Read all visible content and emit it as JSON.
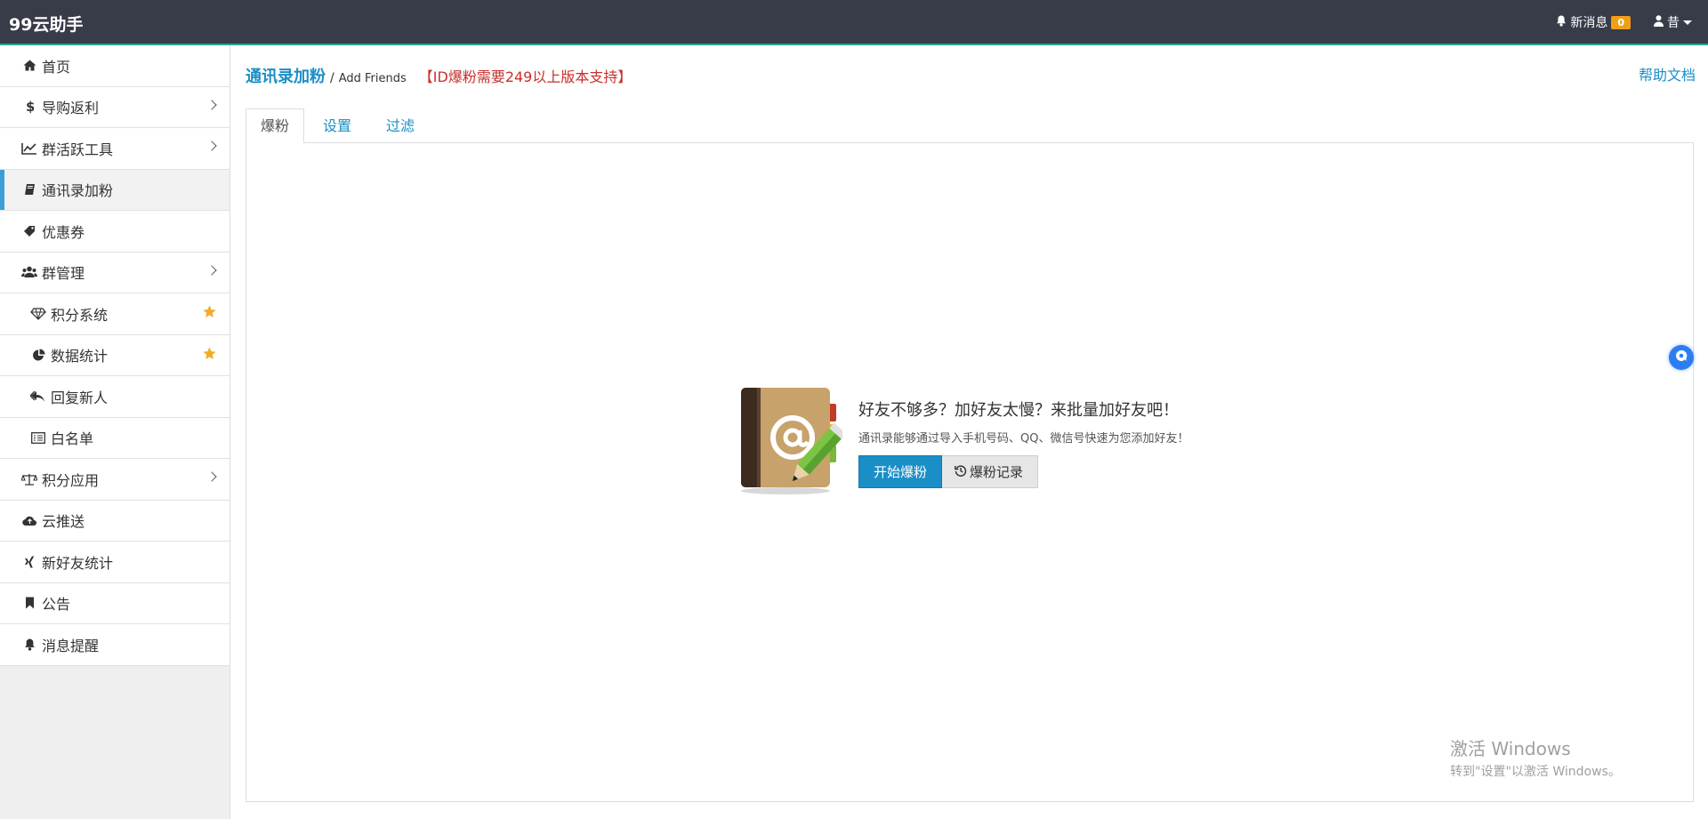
{
  "header": {
    "brand": "99云助手",
    "messages_label": "新消息",
    "messages_count": "0",
    "user_name": "昔"
  },
  "sidebar": {
    "items": [
      {
        "label": "首页",
        "icon": "home-icon"
      },
      {
        "label": "导购返利",
        "icon": "dollar-icon",
        "has_submenu": true
      },
      {
        "label": "群活跃工具",
        "icon": "line-chart-icon",
        "has_submenu": true
      },
      {
        "label": "通讯录加粉",
        "icon": "book-icon",
        "active": true
      },
      {
        "label": "优惠券",
        "icon": "tag-icon"
      },
      {
        "label": "群管理",
        "icon": "users-icon",
        "has_submenu": true
      },
      {
        "label": "积分系统",
        "icon": "diamond-icon",
        "starred": true
      },
      {
        "label": "数据统计",
        "icon": "pie-chart-icon",
        "starred": true
      },
      {
        "label": "回复新人",
        "icon": "reply-all-icon"
      },
      {
        "label": "白名单",
        "icon": "list-icon"
      },
      {
        "label": "积分应用",
        "icon": "balance-scale-icon",
        "has_submenu": true
      },
      {
        "label": "云推送",
        "icon": "cloud-upload-icon"
      },
      {
        "label": "新好友统计",
        "icon": "xing-icon"
      },
      {
        "label": "公告",
        "icon": "bookmark-icon"
      },
      {
        "label": "消息提醒",
        "icon": "bell-icon"
      }
    ]
  },
  "main": {
    "title": "通讯录加粉",
    "subtitle": "Add Friends",
    "notice": "【ID爆粉需要249以上版本支持】",
    "help_link": "帮助文档",
    "tabs": [
      {
        "label": "爆粉",
        "active": true
      },
      {
        "label": "设置"
      },
      {
        "label": "过滤"
      }
    ],
    "hero": {
      "title": "好友不够多？加好友太慢？来批量加好友吧！",
      "description": "通讯录能够通过导入手机号码、QQ、微信号快速为您添加好友！",
      "primary_button": "开始爆粉",
      "secondary_button": "爆粉记录"
    }
  },
  "watermark": {
    "line1": "激活 Windows",
    "line2": "转到\"设置\"以激活 Windows。"
  },
  "colors": {
    "topbar": "#373c48",
    "accent": "#1a8ec6",
    "notice": "#c9302c",
    "badge": "#f0a018",
    "active_marker": "#3a9fd8"
  }
}
